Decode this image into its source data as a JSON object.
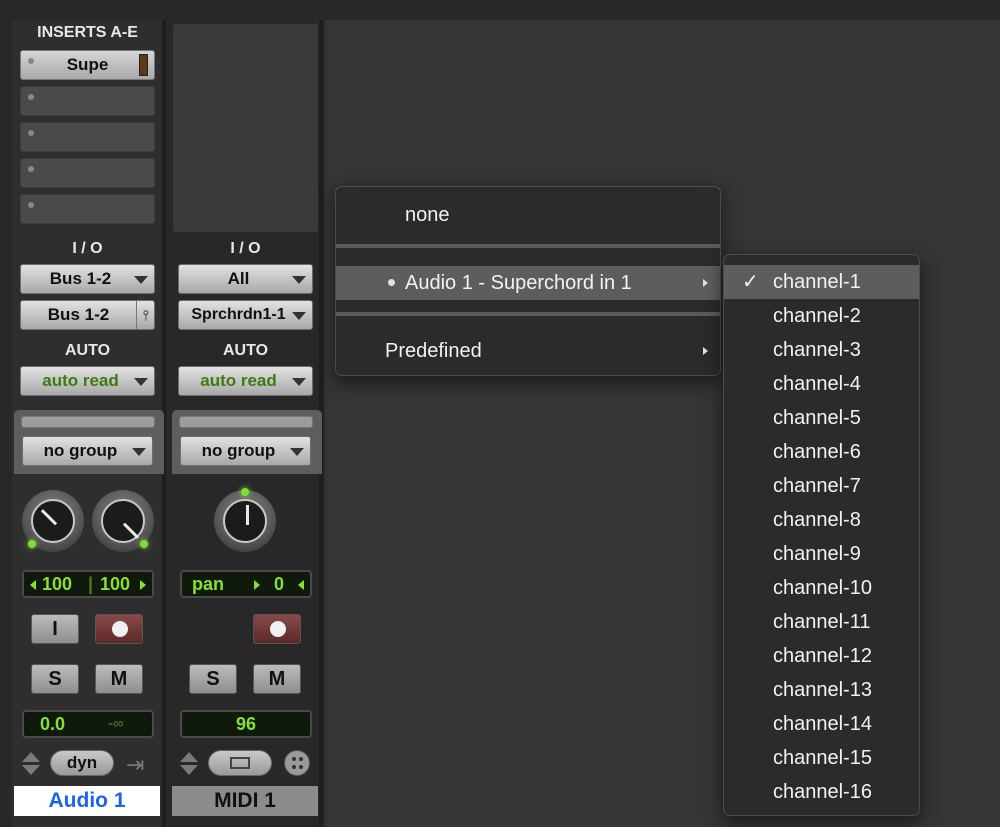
{
  "audio_track": {
    "name": "Audio 1",
    "name_color": "#1a64e6",
    "inserts_header": "INSERTS A-E",
    "insert_a": "Supe",
    "io_header": "I / O",
    "input": "Bus 1-2",
    "output": "Bus 1-2",
    "auto_header": "AUTO",
    "automation": "auto read",
    "group": "no group",
    "pan_left": "100",
    "pan_right": "100",
    "input_monitor_label": "I",
    "solo_label": "S",
    "mute_label": "M",
    "volume": "0.0",
    "peak": "-∞",
    "dyn_label": "dyn"
  },
  "midi_track": {
    "name": "MIDI 1",
    "io_header": "I / O",
    "input": "All",
    "output": "Sprchrdn1-1",
    "auto_header": "AUTO",
    "automation": "auto read",
    "group": "no group",
    "pan_label": "pan",
    "pan_value": "0",
    "solo_label": "S",
    "mute_label": "M",
    "velocity": "96"
  },
  "output_menu": {
    "items": {
      "none": "none",
      "instrument": "Audio 1 - Superchord in 1",
      "predefined": "Predefined"
    }
  },
  "channel_submenu": {
    "selected": "channel-1",
    "items": [
      "channel-1",
      "channel-2",
      "channel-3",
      "channel-4",
      "channel-5",
      "channel-6",
      "channel-7",
      "channel-8",
      "channel-9",
      "channel-10",
      "channel-11",
      "channel-12",
      "channel-13",
      "channel-14",
      "channel-15",
      "channel-16"
    ]
  }
}
